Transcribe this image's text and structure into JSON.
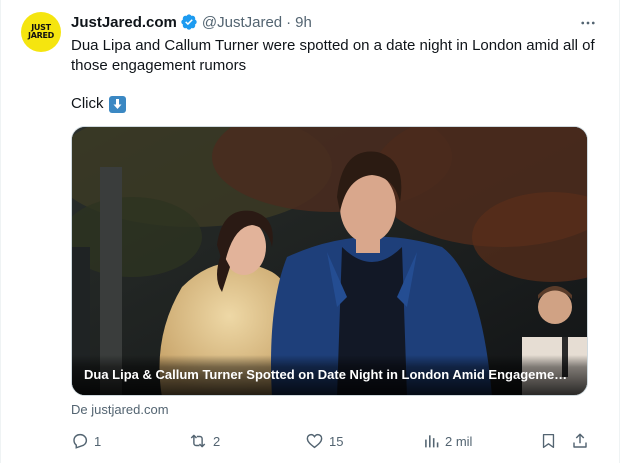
{
  "tweet": {
    "avatar_text": [
      "JUST",
      "JARED"
    ],
    "display_name": "JustJared.com",
    "handle": "@JustJared",
    "separator": "·",
    "time": "9h",
    "text": "Dua Lipa and Callum Turner were spotted on a date night in London amid all of those engagement rumors",
    "click_text": "Click",
    "click_emoji": "down-arrow-emoji",
    "card": {
      "title": "Dua Lipa & Callum Turner Spotted on Date Night in London Amid Engagement ..."
    },
    "source": "De justjared.com",
    "actions": {
      "replies": "1",
      "retweets": "2",
      "likes": "15",
      "views": "2 mil"
    }
  },
  "colors": {
    "avatar_bg": "#f5e50f",
    "verified": "#1d9bf0",
    "secondary_text": "#536471",
    "emoji_bg": "#3b88c3"
  },
  "icons": {
    "more": "more-horizontal-icon",
    "verified": "verified-badge-icon",
    "reply": "reply-icon",
    "retweet": "retweet-icon",
    "like": "heart-icon",
    "views": "views-chart-icon",
    "bookmark": "bookmark-icon",
    "share": "share-icon"
  }
}
